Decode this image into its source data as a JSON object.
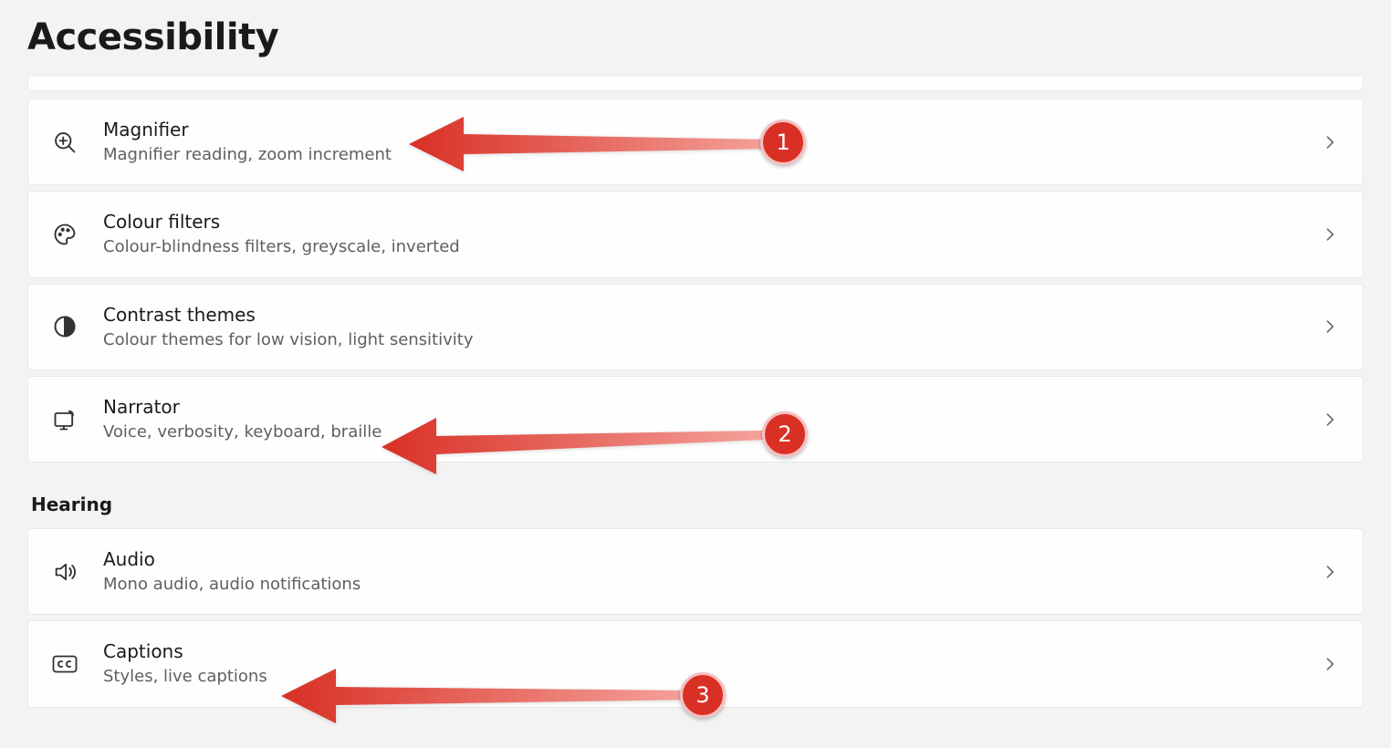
{
  "page": {
    "title": "Accessibility"
  },
  "sections": {
    "hearing_heading": "Hearing"
  },
  "items": {
    "magnifier": {
      "title": "Magnifier",
      "subtitle": "Magnifier reading, zoom increment"
    },
    "colour_filters": {
      "title": "Colour filters",
      "subtitle": "Colour-blindness filters, greyscale, inverted"
    },
    "contrast": {
      "title": "Contrast themes",
      "subtitle": "Colour themes for low vision, light sensitivity"
    },
    "narrator": {
      "title": "Narrator",
      "subtitle": "Voice, verbosity, keyboard, braille"
    },
    "audio": {
      "title": "Audio",
      "subtitle": "Mono audio, audio notifications"
    },
    "captions": {
      "title": "Captions",
      "subtitle": "Styles, live captions"
    }
  },
  "annotations": {
    "a1": "1",
    "a2": "2",
    "a3": "3"
  }
}
